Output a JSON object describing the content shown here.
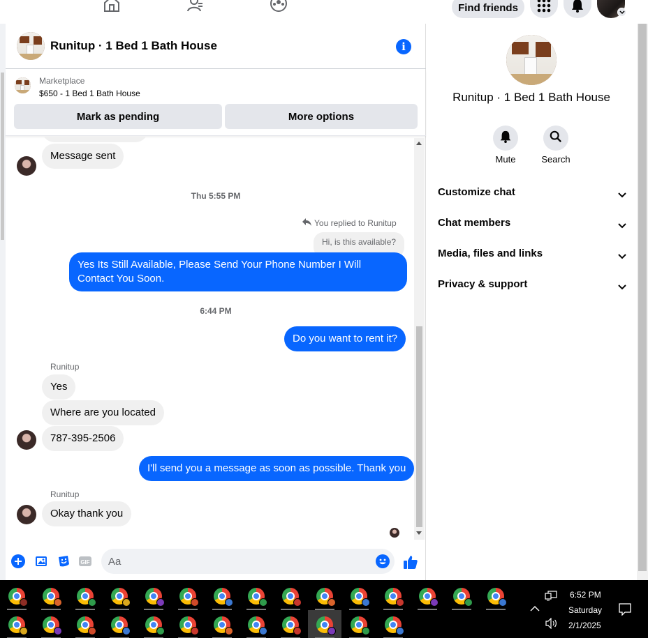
{
  "topnav": {
    "find_friends": "Find friends"
  },
  "chat_header": {
    "title": "Runitup · 1 Bed 1 Bath House"
  },
  "marketplace": {
    "label": "Marketplace",
    "item": "$650 - 1 Bed 1 Bath House",
    "mark_pending": "Mark as pending",
    "more_options": "More options"
  },
  "messages": {
    "msg_sent": "Message sent",
    "stamp1": "Thu 5:55 PM",
    "replied_to": "You replied to Runitup",
    "quoted": "Hi, is this available?",
    "out1": "Yes Its Still Available, Please Send Your Phone Number I Will Contact You Soon.",
    "stamp2": "6:44 PM",
    "out2": "Do you want to rent it?",
    "sender1": "Runitup",
    "in1": "Yes",
    "in2": "Where are you located",
    "in3": "787-395-2506",
    "out3": "I'll send you a message as soon as possible. Thank you",
    "sender2": "Runitup",
    "in4": "Okay thank you"
  },
  "composer": {
    "placeholder": "Aa"
  },
  "right_panel": {
    "title": "Runitup · 1 Bed 1 Bath House",
    "mute": "Mute",
    "search": "Search",
    "rows": [
      "Customize chat",
      "Chat members",
      "Media, files and links",
      "Privacy & support"
    ]
  },
  "taskbar": {
    "time": "6:52 PM",
    "day": "Saturday",
    "date": "2/1/2025"
  },
  "colors": {
    "accent": "#0866ff",
    "bubble_in": "#f0f0f0",
    "button_gray": "#e4e6eb"
  },
  "icons": [
    "home-icon",
    "friends-icon",
    "groups-icon",
    "grid-menu-icon",
    "bell-icon",
    "info-icon",
    "plus-icon",
    "image-icon",
    "sticker-icon",
    "gif-icon",
    "emoji-icon",
    "thumbs-up-icon",
    "search-icon",
    "chevron-down-icon",
    "reply-icon",
    "chrome-icon",
    "network-icon",
    "volume-icon",
    "notification-icon"
  ]
}
